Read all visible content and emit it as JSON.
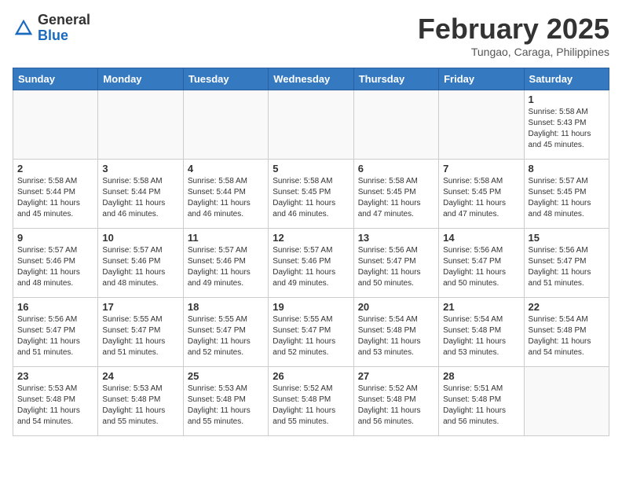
{
  "header": {
    "logo_line1": "General",
    "logo_line2": "Blue",
    "month_title": "February 2025",
    "location": "Tungao, Caraga, Philippines"
  },
  "weekdays": [
    "Sunday",
    "Monday",
    "Tuesday",
    "Wednesday",
    "Thursday",
    "Friday",
    "Saturday"
  ],
  "weeks": [
    [
      {
        "day": "",
        "info": ""
      },
      {
        "day": "",
        "info": ""
      },
      {
        "day": "",
        "info": ""
      },
      {
        "day": "",
        "info": ""
      },
      {
        "day": "",
        "info": ""
      },
      {
        "day": "",
        "info": ""
      },
      {
        "day": "1",
        "info": "Sunrise: 5:58 AM\nSunset: 5:43 PM\nDaylight: 11 hours\nand 45 minutes."
      }
    ],
    [
      {
        "day": "2",
        "info": "Sunrise: 5:58 AM\nSunset: 5:44 PM\nDaylight: 11 hours\nand 45 minutes."
      },
      {
        "day": "3",
        "info": "Sunrise: 5:58 AM\nSunset: 5:44 PM\nDaylight: 11 hours\nand 46 minutes."
      },
      {
        "day": "4",
        "info": "Sunrise: 5:58 AM\nSunset: 5:44 PM\nDaylight: 11 hours\nand 46 minutes."
      },
      {
        "day": "5",
        "info": "Sunrise: 5:58 AM\nSunset: 5:45 PM\nDaylight: 11 hours\nand 46 minutes."
      },
      {
        "day": "6",
        "info": "Sunrise: 5:58 AM\nSunset: 5:45 PM\nDaylight: 11 hours\nand 47 minutes."
      },
      {
        "day": "7",
        "info": "Sunrise: 5:58 AM\nSunset: 5:45 PM\nDaylight: 11 hours\nand 47 minutes."
      },
      {
        "day": "8",
        "info": "Sunrise: 5:57 AM\nSunset: 5:45 PM\nDaylight: 11 hours\nand 48 minutes."
      }
    ],
    [
      {
        "day": "9",
        "info": "Sunrise: 5:57 AM\nSunset: 5:46 PM\nDaylight: 11 hours\nand 48 minutes."
      },
      {
        "day": "10",
        "info": "Sunrise: 5:57 AM\nSunset: 5:46 PM\nDaylight: 11 hours\nand 48 minutes."
      },
      {
        "day": "11",
        "info": "Sunrise: 5:57 AM\nSunset: 5:46 PM\nDaylight: 11 hours\nand 49 minutes."
      },
      {
        "day": "12",
        "info": "Sunrise: 5:57 AM\nSunset: 5:46 PM\nDaylight: 11 hours\nand 49 minutes."
      },
      {
        "day": "13",
        "info": "Sunrise: 5:56 AM\nSunset: 5:47 PM\nDaylight: 11 hours\nand 50 minutes."
      },
      {
        "day": "14",
        "info": "Sunrise: 5:56 AM\nSunset: 5:47 PM\nDaylight: 11 hours\nand 50 minutes."
      },
      {
        "day": "15",
        "info": "Sunrise: 5:56 AM\nSunset: 5:47 PM\nDaylight: 11 hours\nand 51 minutes."
      }
    ],
    [
      {
        "day": "16",
        "info": "Sunrise: 5:56 AM\nSunset: 5:47 PM\nDaylight: 11 hours\nand 51 minutes."
      },
      {
        "day": "17",
        "info": "Sunrise: 5:55 AM\nSunset: 5:47 PM\nDaylight: 11 hours\nand 51 minutes."
      },
      {
        "day": "18",
        "info": "Sunrise: 5:55 AM\nSunset: 5:47 PM\nDaylight: 11 hours\nand 52 minutes."
      },
      {
        "day": "19",
        "info": "Sunrise: 5:55 AM\nSunset: 5:47 PM\nDaylight: 11 hours\nand 52 minutes."
      },
      {
        "day": "20",
        "info": "Sunrise: 5:54 AM\nSunset: 5:48 PM\nDaylight: 11 hours\nand 53 minutes."
      },
      {
        "day": "21",
        "info": "Sunrise: 5:54 AM\nSunset: 5:48 PM\nDaylight: 11 hours\nand 53 minutes."
      },
      {
        "day": "22",
        "info": "Sunrise: 5:54 AM\nSunset: 5:48 PM\nDaylight: 11 hours\nand 54 minutes."
      }
    ],
    [
      {
        "day": "23",
        "info": "Sunrise: 5:53 AM\nSunset: 5:48 PM\nDaylight: 11 hours\nand 54 minutes."
      },
      {
        "day": "24",
        "info": "Sunrise: 5:53 AM\nSunset: 5:48 PM\nDaylight: 11 hours\nand 55 minutes."
      },
      {
        "day": "25",
        "info": "Sunrise: 5:53 AM\nSunset: 5:48 PM\nDaylight: 11 hours\nand 55 minutes."
      },
      {
        "day": "26",
        "info": "Sunrise: 5:52 AM\nSunset: 5:48 PM\nDaylight: 11 hours\nand 55 minutes."
      },
      {
        "day": "27",
        "info": "Sunrise: 5:52 AM\nSunset: 5:48 PM\nDaylight: 11 hours\nand 56 minutes."
      },
      {
        "day": "28",
        "info": "Sunrise: 5:51 AM\nSunset: 5:48 PM\nDaylight: 11 hours\nand 56 minutes."
      },
      {
        "day": "",
        "info": ""
      }
    ]
  ]
}
